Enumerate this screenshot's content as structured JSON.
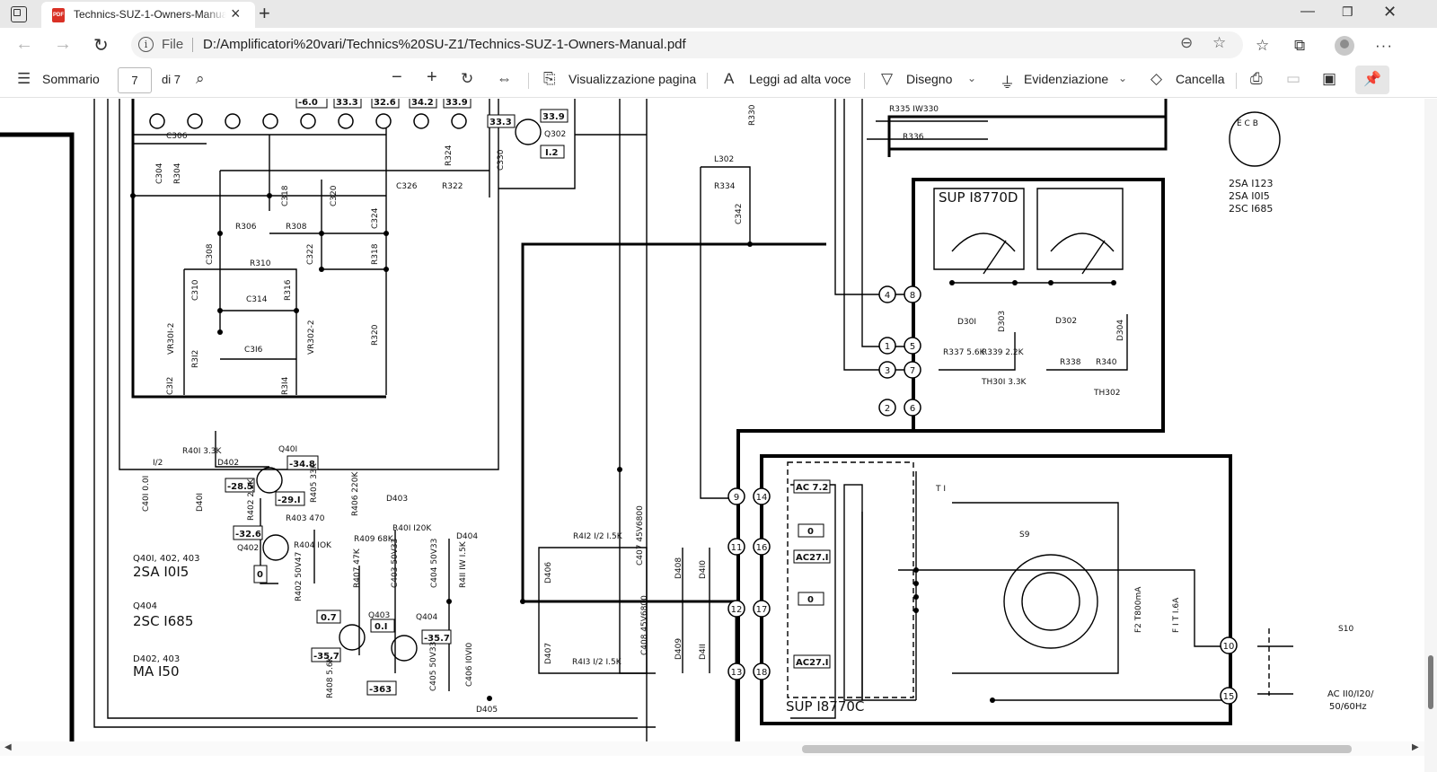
{
  "browser": {
    "tab_title": "Technics-SUZ-1-Owners-Manual.pdf",
    "pdf_badge": "PDF",
    "file_label": "File",
    "url": "D:/Amplificatori%20vari/Technics%20SU-Z1/Technics-SUZ-1-Owners-Manual.pdf"
  },
  "pdf_toolbar": {
    "contents_label": "Sommario",
    "page_current": "7",
    "page_total": "di 7",
    "page_view_label": "Visualizzazione pagina",
    "read_aloud_label": "Leggi ad alta voce",
    "draw_label": "Disegno",
    "highlight_label": "Evidenziazione",
    "erase_label": "Cancella"
  },
  "schematic": {
    "meter_model": "SUP I8770D",
    "psu_model": "SUP I8770C",
    "pinout_header": "E C B",
    "transistor_list": [
      "2SA I123",
      "2SA I0I5",
      "2SC I685"
    ],
    "q401_group": "Q40I, 402, 403",
    "q401_type": "2SA I0I5",
    "q404_group": "Q404",
    "q404_type": "2SC I685",
    "d402_group": "D402, 403",
    "d402_type": "MA I50",
    "mains": "AC II0/I20/",
    "mains_freq": "50/60Hz",
    "fuse_f2": "F2 T800mA",
    "fuse_f1": "F I T I.6A",
    "voltages": [
      "-34.8",
      "-28.5",
      "-29.I",
      "-32.6",
      "0",
      "0.7",
      "0.I",
      "-35.7",
      "-35.7",
      "-363",
      "33.3",
      "33.9",
      "I.2",
      "-6.0",
      "33.3",
      "32.6",
      "34.2",
      "33.9"
    ],
    "ac_labels": [
      "AC 7.2",
      "0",
      "AC27.I",
      "0",
      "AC27.I"
    ],
    "parts": [
      "R335 IW330",
      "R336",
      "L302",
      "R334",
      "C342",
      "R330",
      "C326",
      "R322",
      "R324",
      "C330",
      "Q302",
      "C306",
      "C304",
      "R304",
      "C318",
      "C320",
      "R306",
      "R308",
      "C324",
      "C308",
      "R310",
      "C322",
      "R318",
      "C310",
      "C314",
      "R316",
      "VR30I-2",
      "VR302-2",
      "C3I6",
      "R3I2",
      "R320",
      "C3I2",
      "R3I4",
      "D30I",
      "D303",
      "D302",
      "D304",
      "R337 5.6K",
      "R339 2.2K",
      "TH30I 3.3K",
      "R338",
      "R340",
      "TH302",
      "S9",
      "S10",
      "T I",
      "R40I 3.3K",
      "D402",
      "Q40I",
      "R402 2.2K",
      "R403 470",
      "R405 33K",
      "R406 220K",
      "D403",
      "R40I I20K",
      "Q402",
      "R404 IOK",
      "R409 68K",
      "D404",
      "R407 47K",
      "C403 50V33",
      "C404 50V33",
      "R4II IW I.5K",
      "R402 50V47",
      "Q403",
      "Q404",
      "C405 50V33",
      "C406 I0VI0",
      "D405",
      "R408 5.6K",
      "C40I 0.0I",
      "D40I",
      "R4I2 I/2 I.5K",
      "R4I3 I/2 I.5K",
      "C407 45V6800",
      "C408 45V6800",
      "D406",
      "D407",
      "D408",
      "D409",
      "D4I0",
      "D4II",
      "I/2"
    ]
  }
}
